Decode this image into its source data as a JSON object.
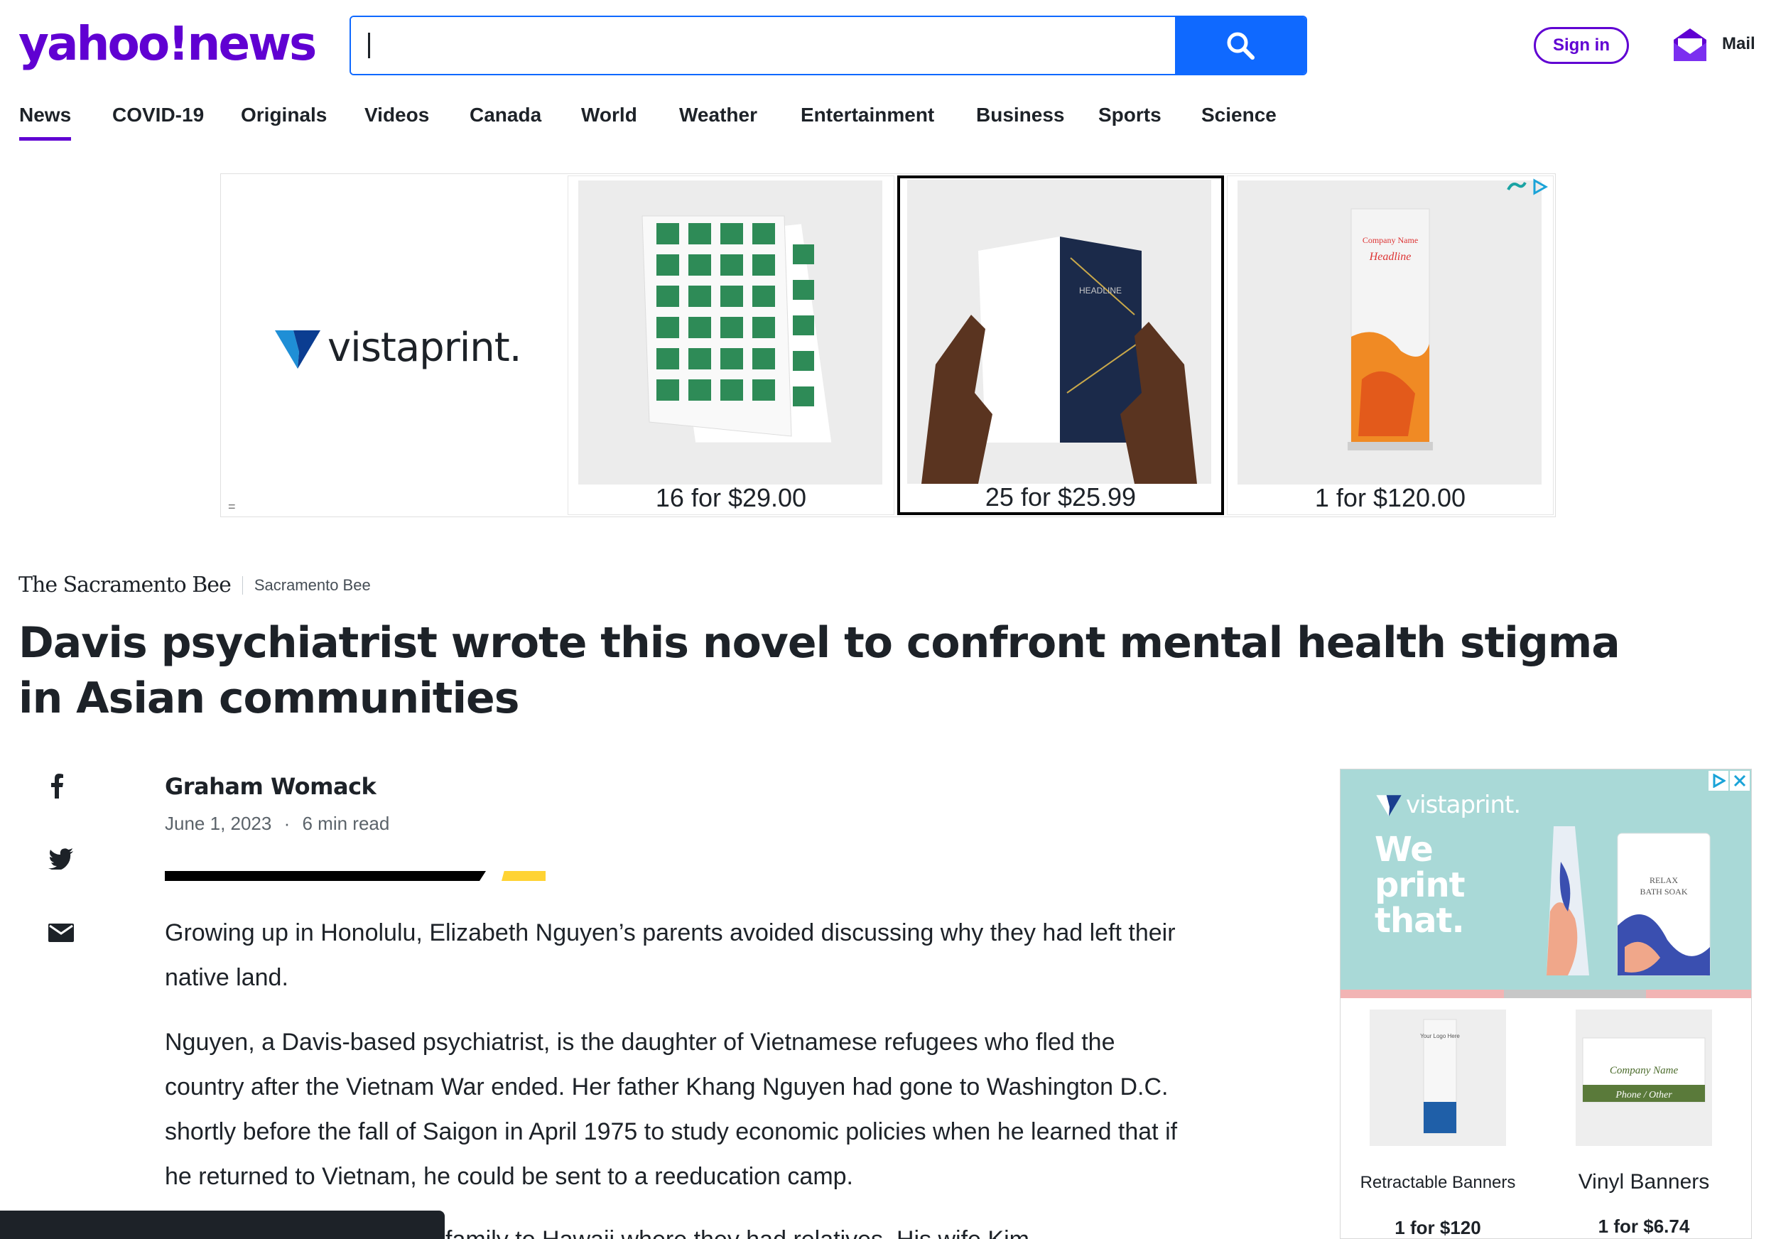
{
  "header": {
    "logo_text": "yahoo!news",
    "search_value": "",
    "signin_label": "Sign in",
    "mail_label": "Mail"
  },
  "nav": {
    "items": [
      "News",
      "COVID-19",
      "Originals",
      "Videos",
      "Canada",
      "World",
      "Weather",
      "Entertainment",
      "Business",
      "Sports",
      "Science"
    ],
    "active": "News"
  },
  "top_ad": {
    "brand": "vistaprint.",
    "cards": [
      {
        "price": "16 for $29.00"
      },
      {
        "price": "25 for $25.99"
      },
      {
        "price": "1 for $120.00"
      }
    ],
    "selected_index": 1,
    "card_texts": {
      "brochure_headline": "HEADLINE",
      "banner_company": "Company Name",
      "banner_headline": "Headline"
    }
  },
  "article": {
    "source_logo": "The Sacramento Bee",
    "source_name": "Sacramento Bee",
    "headline": "Davis psychiatrist wrote this novel to confront mental health stigma in Asian communities",
    "author": "Graham Womack",
    "date": "June 1, 2023",
    "separator": "·",
    "read_time": "6 min read",
    "paragraphs": [
      "Growing up in Honolulu, Elizabeth Nguyen’s parents avoided discussing why they had left their native land.",
      "Nguyen, a Davis-based psychiatrist, is the daughter of Vietnamese refugees who fled the country after the Vietnam War ended. Her father Khang Nguyen had gone to Washington D.C. shortly before the fall of Saigon in April 1975 to study economic policies when he learned that if he returned to Vietnam, he could be sent to a reeducation camp.",
      "He then worked to get his family to Hawaii where they had relatives. His wife Kim"
    ]
  },
  "share": {
    "icons": [
      "facebook-icon",
      "twitter-icon",
      "email-icon"
    ]
  },
  "side_ad": {
    "brand": "vistaprint.",
    "tagline": [
      "We",
      "print",
      "that."
    ],
    "product_label_1": "RELAX",
    "product_label_2": "BATH SOAK",
    "items": [
      {
        "name": "Retractable Banners",
        "price": "1 for $120",
        "img_text": "Your Logo Here"
      },
      {
        "name": "Vinyl Banners",
        "price": "1 for $6.74",
        "img_text_1": "Company Name",
        "img_text_2": "Phone / Other"
      }
    ]
  },
  "colors": {
    "yahoo_purple": "#6001d2",
    "search_blue": "#0f69ff",
    "text_dark": "#1d2228",
    "accent_yellow": "#ffd333"
  }
}
